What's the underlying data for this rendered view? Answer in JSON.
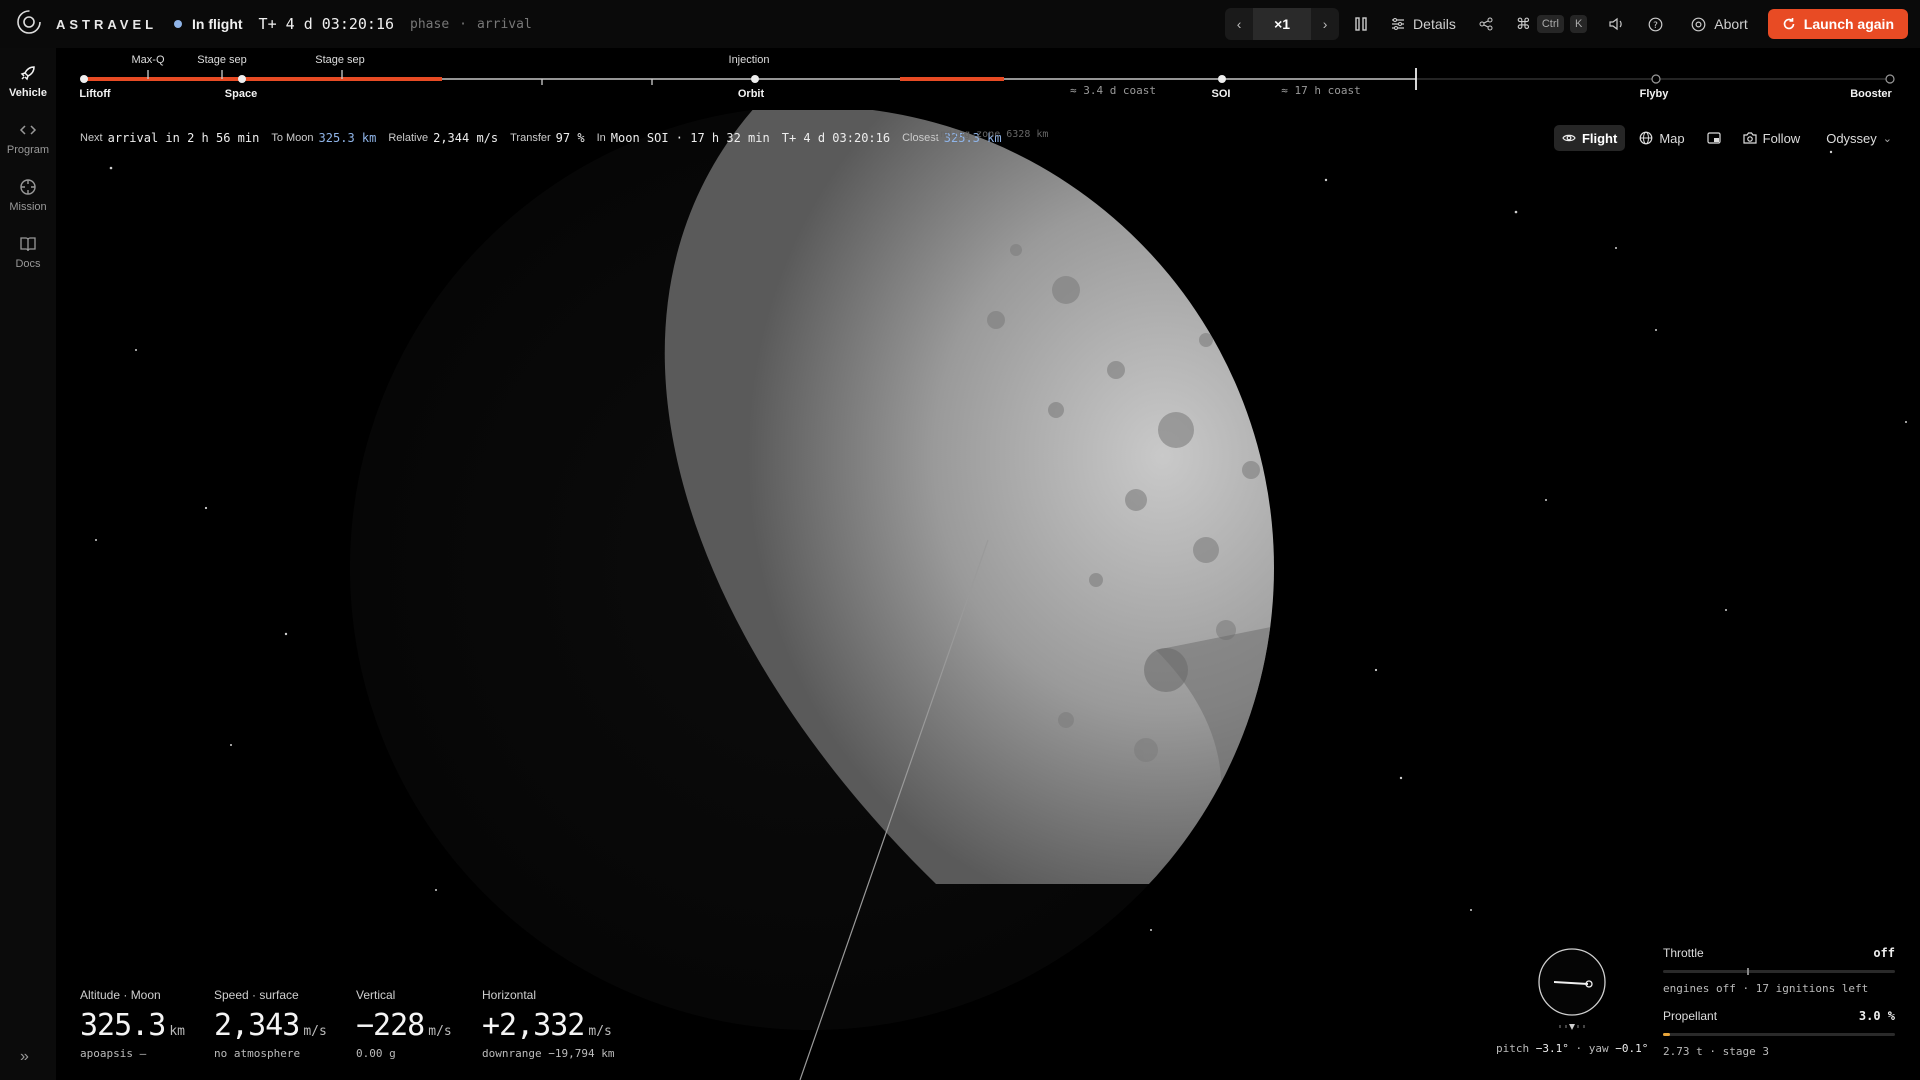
{
  "app": {
    "brand": "ASTRAVEL"
  },
  "status": {
    "state": "In flight",
    "clock": "T+ 4 d 03:20:16",
    "phase_label": "phase",
    "separator": "·",
    "phase": "arrival"
  },
  "toolbar": {
    "speed": "×1",
    "details_label": "Details",
    "shortcut_mod": "Ctrl",
    "shortcut_key": "K",
    "abort_label": "Abort",
    "launch_label": "Launch again",
    "accent_color": "#e84b24"
  },
  "sidebar": {
    "items": [
      {
        "label": "Vehicle",
        "icon": "rocket-icon",
        "active": true
      },
      {
        "label": "Program",
        "icon": "code-icon",
        "active": false
      },
      {
        "label": "Mission",
        "icon": "crosshair-icon",
        "active": false
      },
      {
        "label": "Docs",
        "icon": "book-icon",
        "active": false
      }
    ],
    "collapse_glyph": "»"
  },
  "timeline": {
    "events_above": [
      "Max-Q",
      "Stage sep",
      "Stage sep",
      "Injection"
    ],
    "milestones": [
      "Liftoff",
      "Space",
      "Orbit",
      "SOI",
      "Flyby",
      "Booster"
    ],
    "coast_labels": [
      "≈ 3.4 d coast",
      "≈ 17 h coast"
    ]
  },
  "telemetry": {
    "next_label": "Next",
    "next_event": "arrival in 2 h 56 min",
    "to_label": "To Moon",
    "to_value": "325.3 km",
    "relative_label": "Relative",
    "relative_value": "2,344 m/s",
    "transfer_label": "Transfer",
    "transfer_value": "97 %",
    "in_label": "In",
    "in_value": "Moon SOI · 17 h 32 min",
    "clock": "T+ 4 d 03:20:16",
    "closest_label": "Closest",
    "closest_value": "325.3 km",
    "closest_overlay": "landing zone 6328 km"
  },
  "view": {
    "flight_label": "Flight",
    "map_label": "Map",
    "follow_label": "Follow",
    "vehicle_label": "Odyssey"
  },
  "readouts": [
    {
      "label": "Altitude · Moon",
      "value": "325.3",
      "unit": "km",
      "sub": "apoapsis —"
    },
    {
      "label": "Speed · surface",
      "value": "2,343",
      "unit": "m/s",
      "sub": "no atmosphere"
    },
    {
      "label": "Vertical",
      "value": "−228",
      "unit": "m/s",
      "sub": "0.00 g"
    },
    {
      "label": "Horizontal",
      "value": "+2,332",
      "unit": "m/s",
      "sub": "downrange −19,794 km"
    }
  ],
  "attitude": {
    "pitch_label": "pitch",
    "pitch_value": "−3.1°",
    "sep": "·",
    "yaw_label": "yaw",
    "yaw_value": "−0.1°"
  },
  "engine": {
    "throttle_label": "Throttle",
    "throttle_state": "off",
    "throttle_level": 0,
    "throttle_sub": "engines off · 17 ignitions left",
    "propellant_label": "Propellant",
    "propellant_value": "3.0 %",
    "propellant_level": 0.03,
    "propellant_sub": "2.73 t · stage 3",
    "propellant_color": "#e8a53a"
  }
}
